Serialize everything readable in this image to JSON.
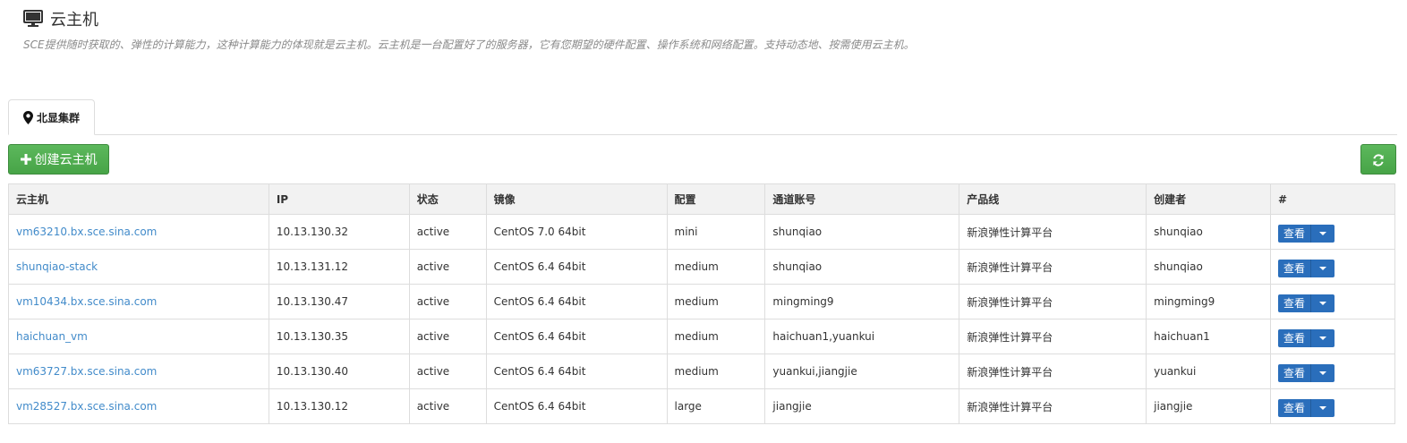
{
  "header": {
    "title": "云主机",
    "description": "SCE提供随时获取的、弹性的计算能力，这种计算能力的体现就是云主机。云主机是一台配置好了的服务器，它有您期望的硬件配置、操作系统和网络配置。支持动态地、按需使用云主机。",
    "icon": "monitor-icon"
  },
  "tabs": [
    {
      "label": "北显集群",
      "icon": "map-marker-icon",
      "active": true
    }
  ],
  "toolbar": {
    "create_label": "创建云主机",
    "refresh_icon": "refresh-icon"
  },
  "table": {
    "columns": [
      "云主机",
      "IP",
      "状态",
      "镜像",
      "配置",
      "通道账号",
      "产品线",
      "创建者",
      "#"
    ],
    "action_label": "查看",
    "rows": [
      {
        "name": "vm63210.bx.sce.sina.com",
        "ip": "10.13.130.32",
        "status": "active",
        "image": "CentOS 7.0 64bit",
        "flavor": "mini",
        "account": "shunqiao",
        "product": "新浪弹性计算平台",
        "creator": "shunqiao"
      },
      {
        "name": "shunqiao-stack",
        "ip": "10.13.131.12",
        "status": "active",
        "image": "CentOS 6.4 64bit",
        "flavor": "medium",
        "account": "shunqiao",
        "product": "新浪弹性计算平台",
        "creator": "shunqiao"
      },
      {
        "name": "vm10434.bx.sce.sina.com",
        "ip": "10.13.130.47",
        "status": "active",
        "image": "CentOS 6.4 64bit",
        "flavor": "medium",
        "account": "mingming9",
        "product": "新浪弹性计算平台",
        "creator": "mingming9"
      },
      {
        "name": "haichuan_vm",
        "ip": "10.13.130.35",
        "status": "active",
        "image": "CentOS 6.4 64bit",
        "flavor": "medium",
        "account": "haichuan1,yuankui",
        "product": "新浪弹性计算平台",
        "creator": "haichuan1"
      },
      {
        "name": "vm63727.bx.sce.sina.com",
        "ip": "10.13.130.40",
        "status": "active",
        "image": "CentOS 6.4 64bit",
        "flavor": "medium",
        "account": "yuankui,jiangjie",
        "product": "新浪弹性计算平台",
        "creator": "yuankui"
      },
      {
        "name": "vm28527.bx.sce.sina.com",
        "ip": "10.13.130.12",
        "status": "active",
        "image": "CentOS 6.4 64bit",
        "flavor": "large",
        "account": "jiangjie",
        "product": "新浪弹性计算平台",
        "creator": "jiangjie"
      }
    ]
  },
  "colors": {
    "primary_green": "#5cb85c",
    "link_blue": "#428bca",
    "action_blue": "#2a6ebb"
  }
}
